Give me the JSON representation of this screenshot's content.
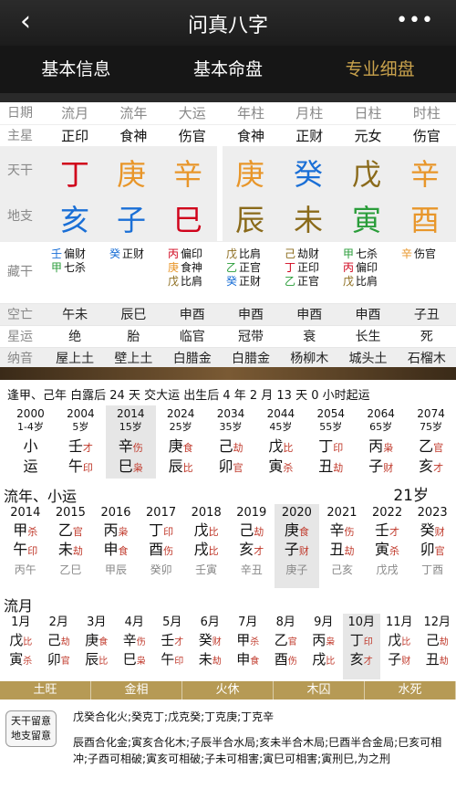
{
  "header": {
    "title": "问真八字",
    "back": "‹",
    "more": "•••"
  },
  "tabs": [
    "基本信息",
    "基本命盘",
    "专业细盘"
  ],
  "grid": {
    "head_label": "日期",
    "heads": [
      "流月",
      "流年",
      "大运",
      "年柱",
      "月柱",
      "日柱",
      "时柱"
    ],
    "star_label": "主星",
    "stars": [
      "正印",
      "食神",
      "伤官",
      "食神",
      "正财",
      "元女",
      "伤官"
    ],
    "tg_label": "天干",
    "dz_label": "地支",
    "tiangan": [
      {
        "ch": "丁",
        "color": "#d0021b"
      },
      {
        "ch": "庚",
        "color": "#e8962a"
      },
      {
        "ch": "辛",
        "color": "#e8962a"
      },
      {
        "ch": "庚",
        "color": "#e8962a"
      },
      {
        "ch": "癸",
        "color": "#1a6fd6"
      },
      {
        "ch": "戊",
        "color": "#8a6a1a"
      },
      {
        "ch": "辛",
        "color": "#e8962a"
      }
    ],
    "dizhi": [
      {
        "ch": "亥",
        "color": "#1a6fd6"
      },
      {
        "ch": "子",
        "color": "#1a6fd6"
      },
      {
        "ch": "巳",
        "color": "#d0021b"
      },
      {
        "ch": "辰",
        "color": "#8a6a1a"
      },
      {
        "ch": "未",
        "color": "#8a6a1a"
      },
      {
        "ch": "寅",
        "color": "#2a9d3a"
      },
      {
        "ch": "酉",
        "color": "#e8962a"
      }
    ],
    "zang_label": "藏干",
    "canggan": [
      [
        {
          "s": "壬",
          "c": "#1a6fd6",
          "t": "偏财"
        },
        {
          "s": "甲",
          "c": "#2a9d3a",
          "t": "七杀"
        }
      ],
      [
        {
          "s": "癸",
          "c": "#1a6fd6",
          "t": "正财"
        }
      ],
      [
        {
          "s": "丙",
          "c": "#d0021b",
          "t": "偏印"
        },
        {
          "s": "庚",
          "c": "#e8962a",
          "t": "食神"
        },
        {
          "s": "戊",
          "c": "#8a6a1a",
          "t": "比肩"
        }
      ],
      [
        {
          "s": "戊",
          "c": "#8a6a1a",
          "t": "比肩"
        },
        {
          "s": "乙",
          "c": "#2a9d3a",
          "t": "正官"
        },
        {
          "s": "癸",
          "c": "#1a6fd6",
          "t": "正财"
        }
      ],
      [
        {
          "s": "己",
          "c": "#8a6a1a",
          "t": "劫财"
        },
        {
          "s": "丁",
          "c": "#d0021b",
          "t": "正印"
        },
        {
          "s": "乙",
          "c": "#2a9d3a",
          "t": "正官"
        }
      ],
      [
        {
          "s": "甲",
          "c": "#2a9d3a",
          "t": "七杀"
        },
        {
          "s": "丙",
          "c": "#d0021b",
          "t": "偏印"
        },
        {
          "s": "戊",
          "c": "#8a6a1a",
          "t": "比肩"
        }
      ],
      [
        {
          "s": "辛",
          "c": "#e8962a",
          "t": "伤官"
        }
      ]
    ],
    "kw_label": "空亡",
    "kongwang": [
      "午未",
      "辰巳",
      "申酉",
      "申酉",
      "申酉",
      "申酉",
      "子丑"
    ],
    "xy_label": "星运",
    "xingyun": [
      "绝",
      "胎",
      "临官",
      "冠带",
      "衰",
      "长生",
      "死"
    ],
    "ny_label": "纳音",
    "nayin": [
      "屋上土",
      "壁上土",
      "白腊金",
      "白腊金",
      "杨柳木",
      "城头土",
      "石榴木"
    ]
  },
  "start_line": "逢甲、己年 白露后 24 天 交大运   出生后 4 年 2 月 13 天 0 小时起运",
  "dayun": [
    {
      "yr": "2000",
      "age": "1-4岁",
      "g": "小",
      "gt": "",
      "z": "运",
      "zt": ""
    },
    {
      "yr": "2004",
      "age": "5岁",
      "g": "壬",
      "gt": "才",
      "z": "午",
      "zt": "印"
    },
    {
      "yr": "2014",
      "age": "15岁",
      "g": "辛",
      "gt": "伤",
      "z": "巳",
      "zt": "枭"
    },
    {
      "yr": "2024",
      "age": "25岁",
      "g": "庚",
      "gt": "食",
      "z": "辰",
      "zt": "比"
    },
    {
      "yr": "2034",
      "age": "35岁",
      "g": "己",
      "gt": "劫",
      "z": "卯",
      "zt": "官"
    },
    {
      "yr": "2044",
      "age": "45岁",
      "g": "戊",
      "gt": "比",
      "z": "寅",
      "zt": "杀"
    },
    {
      "yr": "2054",
      "age": "55岁",
      "g": "丁",
      "gt": "印",
      "z": "丑",
      "zt": "劫"
    },
    {
      "yr": "2064",
      "age": "65岁",
      "g": "丙",
      "gt": "枭",
      "z": "子",
      "zt": "财"
    },
    {
      "yr": "2074",
      "age": "75岁",
      "g": "乙",
      "gt": "官",
      "z": "亥",
      "zt": "才"
    }
  ],
  "liunian_title": "流年、小运",
  "liunian_age": "21岁",
  "liunian": [
    {
      "yr": "2014",
      "g": "甲",
      "gt": "杀",
      "z": "午",
      "zt": "印",
      "xy": "丙午"
    },
    {
      "yr": "2015",
      "g": "乙",
      "gt": "官",
      "z": "未",
      "zt": "劫",
      "xy": "乙巳"
    },
    {
      "yr": "2016",
      "g": "丙",
      "gt": "枭",
      "z": "申",
      "zt": "食",
      "xy": "甲辰"
    },
    {
      "yr": "2017",
      "g": "丁",
      "gt": "印",
      "z": "酉",
      "zt": "伤",
      "xy": "癸卯"
    },
    {
      "yr": "2018",
      "g": "戊",
      "gt": "比",
      "z": "戌",
      "zt": "比",
      "xy": "壬寅"
    },
    {
      "yr": "2019",
      "g": "己",
      "gt": "劫",
      "z": "亥",
      "zt": "才",
      "xy": "辛丑"
    },
    {
      "yr": "2020",
      "g": "庚",
      "gt": "食",
      "z": "子",
      "zt": "财",
      "xy": "庚子"
    },
    {
      "yr": "2021",
      "g": "辛",
      "gt": "伤",
      "z": "丑",
      "zt": "劫",
      "xy": "己亥"
    },
    {
      "yr": "2022",
      "g": "壬",
      "gt": "才",
      "z": "寅",
      "zt": "杀",
      "xy": "戊戌"
    },
    {
      "yr": "2023",
      "g": "癸",
      "gt": "财",
      "z": "卯",
      "zt": "官",
      "xy": "丁酉"
    }
  ],
  "liuyue_title": "流月",
  "liuyue": [
    {
      "mo": "1月",
      "g": "戊",
      "gt": "比",
      "z": "寅",
      "zt": "杀"
    },
    {
      "mo": "2月",
      "g": "己",
      "gt": "劫",
      "z": "卯",
      "zt": "官"
    },
    {
      "mo": "3月",
      "g": "庚",
      "gt": "食",
      "z": "辰",
      "zt": "比"
    },
    {
      "mo": "4月",
      "g": "辛",
      "gt": "伤",
      "z": "巳",
      "zt": "枭"
    },
    {
      "mo": "5月",
      "g": "壬",
      "gt": "才",
      "z": "午",
      "zt": "印"
    },
    {
      "mo": "6月",
      "g": "癸",
      "gt": "财",
      "z": "未",
      "zt": "劫"
    },
    {
      "mo": "7月",
      "g": "甲",
      "gt": "杀",
      "z": "申",
      "zt": "食"
    },
    {
      "mo": "8月",
      "g": "乙",
      "gt": "官",
      "z": "酉",
      "zt": "伤"
    },
    {
      "mo": "9月",
      "g": "丙",
      "gt": "枭",
      "z": "戌",
      "zt": "比"
    },
    {
      "mo": "10月",
      "g": "丁",
      "gt": "印",
      "z": "亥",
      "zt": "才"
    },
    {
      "mo": "11月",
      "g": "戊",
      "gt": "比",
      "z": "子",
      "zt": "财"
    },
    {
      "mo": "12月",
      "g": "己",
      "gt": "劫",
      "z": "丑",
      "zt": "劫"
    }
  ],
  "wuxing": [
    "土旺",
    "金相",
    "火休",
    "木囚",
    "水死"
  ],
  "rel_button": [
    "天干留意",
    "地支留意"
  ],
  "rel_tg": "戊癸合化火;癸克丁;戊克癸;丁克庚;丁克辛",
  "rel_dz": "辰酉合化金;寅亥合化木;子辰半合水局;亥未半合木局;巳酉半合金局;巳亥可相冲;子酉可相破;寅亥可相破;子未可相害;寅巳可相害;寅刑巳,为之刑"
}
